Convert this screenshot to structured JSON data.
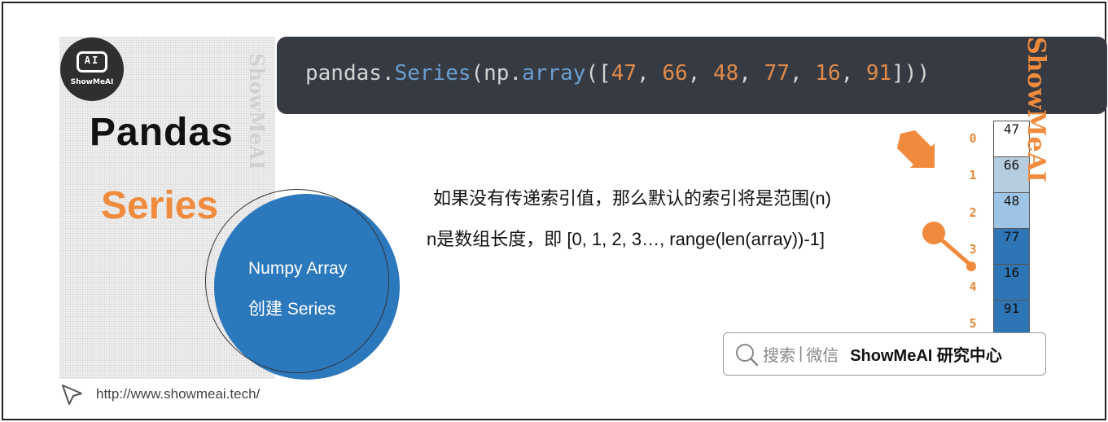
{
  "logo": {
    "icon_text": "AI",
    "brand_text": "ShowMeAI"
  },
  "watermark_vertical_left": "ShowMeAI",
  "watermark_vertical_right": "ShowMeAI",
  "title": {
    "main": "Pandas",
    "sub": "Series"
  },
  "circle": {
    "line1": "Numpy Array",
    "line2": "创建 Series"
  },
  "code": {
    "prefix": "pandas.",
    "func": "Series",
    "mid": "(np.",
    "func2": "array",
    "open": "([",
    "values": [
      "47",
      "66",
      "48",
      "77",
      "16",
      "91"
    ],
    "sep": ", ",
    "close": "]))"
  },
  "description": {
    "line1": "如果没有传递索引值，那么默认的索引将是范围(n)",
    "line2": "n是数组长度，即 [0, 1, 2, 3…, range(len(array))-1]"
  },
  "series_table": {
    "index": [
      "0",
      "1",
      "2",
      "3",
      "4",
      "5"
    ],
    "values": [
      "47",
      "66",
      "48",
      "77",
      "16",
      "91"
    ],
    "cell_colors": [
      "#ffffff",
      "#b6cde0",
      "#9dc3e6",
      "#2e75b6",
      "#2e75b6",
      "#2e75b6"
    ]
  },
  "search": {
    "label1": "搜索",
    "sep": "|",
    "label2": "微信",
    "brand": "ShowMeAI 研究中心"
  },
  "url": "http://www.showmeai.tech/",
  "colors": {
    "accent_orange": "#f08a3c",
    "accent_blue": "#2c78bd",
    "code_bg": "#363a42"
  },
  "icons": [
    "search-icon",
    "cursor-icon",
    "arrow-down-right-icon",
    "pin-icon"
  ]
}
